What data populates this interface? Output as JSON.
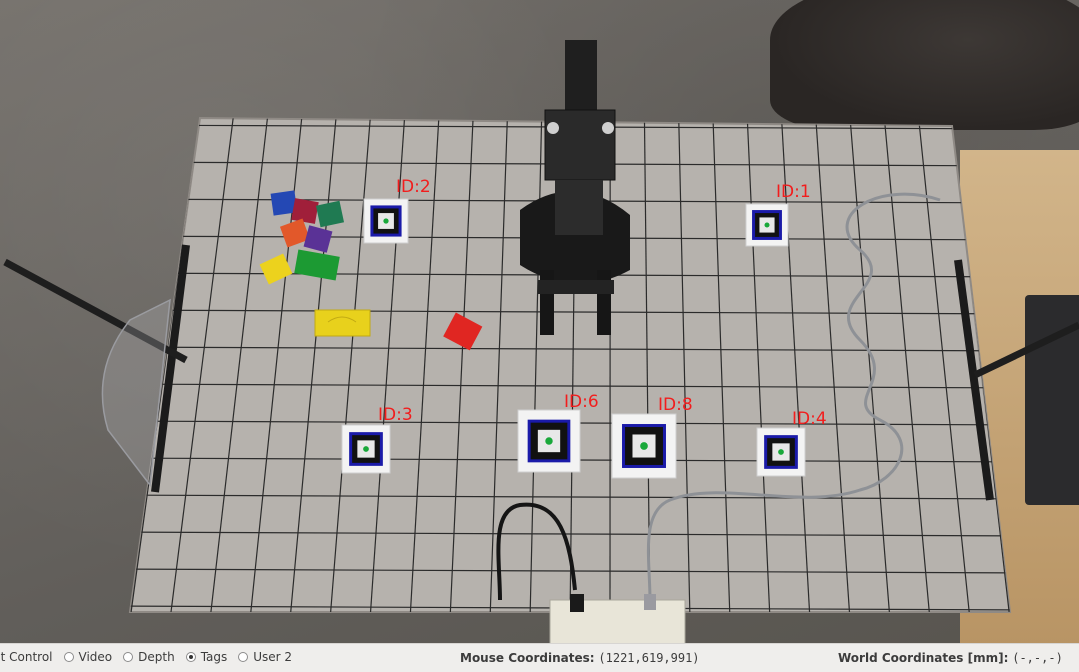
{
  "modes": {
    "items": [
      {
        "label": "ct Control",
        "checked": false,
        "show_radio": false
      },
      {
        "label": "Video",
        "checked": false,
        "show_radio": true
      },
      {
        "label": "Depth",
        "checked": false,
        "show_radio": true
      },
      {
        "label": "Tags",
        "checked": true,
        "show_radio": true
      },
      {
        "label": "User 2",
        "checked": false,
        "show_radio": true
      }
    ]
  },
  "mouse": {
    "label": "Mouse Coordinates:",
    "value": "(1221,619,991)"
  },
  "world": {
    "label": "World Coordinates [mm]:",
    "value": "(-,-,-)"
  },
  "tags": [
    {
      "label": "ID:2"
    },
    {
      "label": "ID:1"
    },
    {
      "label": "ID:3"
    },
    {
      "label": "ID:6"
    },
    {
      "label": "ID:8"
    },
    {
      "label": "ID:4"
    }
  ],
  "colors": {
    "tag_label": "#f21d1d",
    "tag_frame": "#1a1aa8",
    "tag_center": "#19a83a",
    "board": "#b6b2ad",
    "grid_line": "#2b2b2b"
  },
  "icons": {
    "robot": "robot-arm-icon",
    "block": "cube-icon"
  }
}
